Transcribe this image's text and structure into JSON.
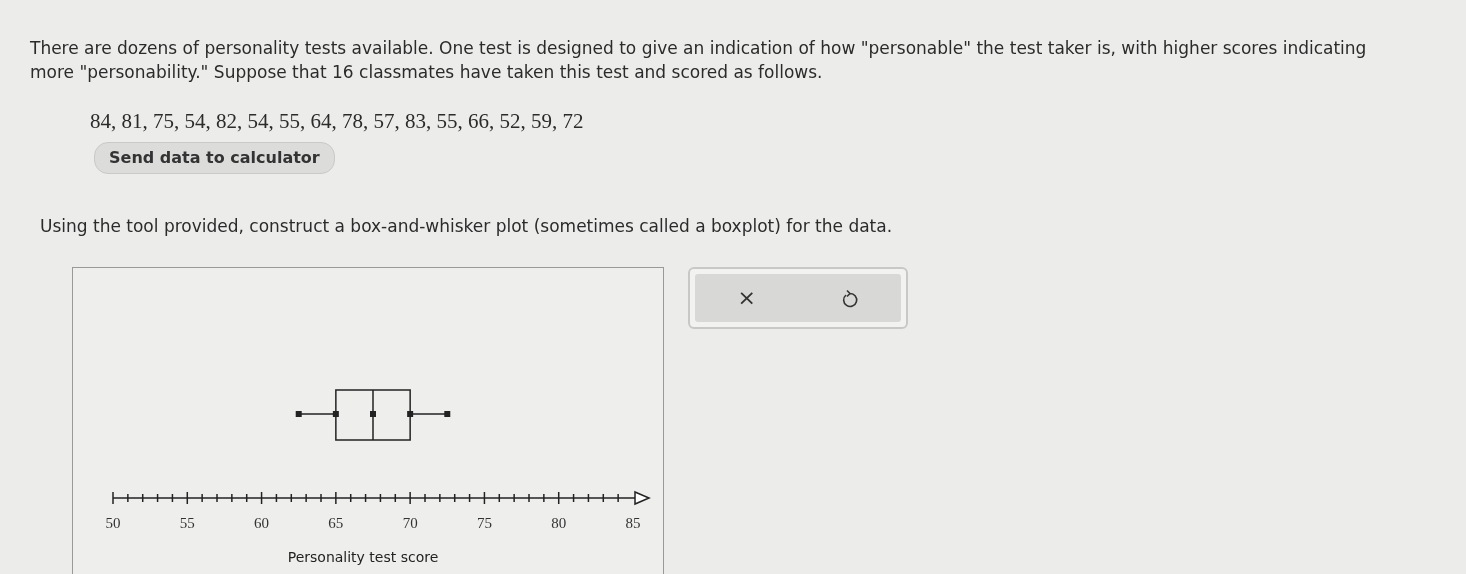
{
  "intro": "There are dozens of personality tests available. One test is designed to give an indication of how \"personable\" the test taker is, with higher scores indicating more \"personability.\" Suppose that 16 classmates have taken this test and scored as follows.",
  "data_values": "84, 81, 75, 54, 82, 54, 55, 64, 78, 57, 83, 55, 66, 52, 59, 72",
  "send_button": "Send data to calculator",
  "instruction": "Using the tool provided, construct a box-and-whisker plot (sometimes called a boxplot) for the data.",
  "plot": {
    "axis_labels": [
      "50",
      "55",
      "60",
      "65",
      "70",
      "75",
      "80",
      "85"
    ],
    "axis_title": "Personality test score"
  },
  "tool_buttons": [
    {
      "kind": "clear",
      "label": "×"
    },
    {
      "kind": "undo"
    }
  ]
}
